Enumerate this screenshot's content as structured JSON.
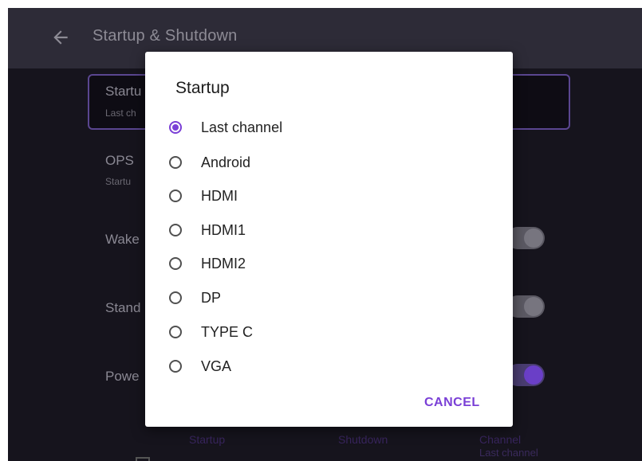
{
  "header": {
    "title": "Startup & Shutdown"
  },
  "background": {
    "startup_row": {
      "title": "Startu",
      "subtitle": "Last ch"
    },
    "ops_row": {
      "title": "OPS",
      "subtitle": "Startu"
    },
    "wake_row": {
      "title": "Wake"
    },
    "standby_row": {
      "title": "Stand"
    },
    "power_row": {
      "title": "Powe"
    },
    "footer": {
      "startup_label": "Startup",
      "shutdown_label": "Shutdown",
      "channel_label": "Channel",
      "channel_value": "Last channel"
    }
  },
  "dialog": {
    "title": "Startup",
    "selected": "Last channel",
    "options": [
      "Last channel",
      "Android",
      "HDMI",
      "HDMI1",
      "HDMI2",
      "DP",
      "TYPE C",
      "VGA"
    ],
    "cancel_label": "CANCEL"
  },
  "colors": {
    "accent": "#7a3fd6",
    "topbar": "#2d2b37",
    "background": "#16141d"
  }
}
